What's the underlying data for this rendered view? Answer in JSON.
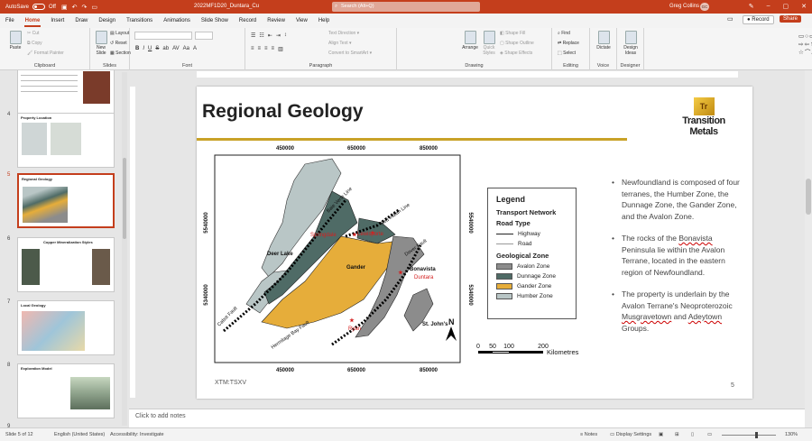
{
  "titlebar": {
    "autosave": "AutoSave",
    "autosave_state": "Off",
    "doc_title": "2022MF1D20_Duntara_Cu",
    "search_placeholder": "Search (Alt+Q)",
    "user": "Greg Collins",
    "initials": "GC"
  },
  "tabs": [
    "File",
    "Home",
    "Insert",
    "Draw",
    "Design",
    "Transitions",
    "Animations",
    "Slide Show",
    "Record",
    "Review",
    "View",
    "Help"
  ],
  "active_tab": "Home",
  "top_right": {
    "record": "Record",
    "share": "Share"
  },
  "ribbon": {
    "clipboard": {
      "label": "Clipboard",
      "paste": "Paste",
      "cut": "Cut",
      "copy": "Copy",
      "format_painter": "Format Painter"
    },
    "slides": {
      "label": "Slides",
      "new_slide": "New Slide",
      "layout": "Layout",
      "reset": "Reset",
      "section": "Section"
    },
    "font": {
      "label": "Font",
      "buttons": [
        "B",
        "I",
        "U",
        "S",
        "ab",
        "AV",
        "Aa",
        "A"
      ]
    },
    "paragraph": {
      "label": "Paragraph",
      "text_direction": "Text Direction",
      "align_text": "Align Text",
      "convert_smartart": "Convert to SmartArt"
    },
    "drawing": {
      "label": "Drawing",
      "arrange": "Arrange",
      "quick_styles": "Quick Styles",
      "shape_fill": "Shape Fill",
      "shape_outline": "Shape Outline",
      "shape_effects": "Shape Effects"
    },
    "editing": {
      "label": "Editing",
      "find": "Find",
      "replace": "Replace",
      "select": "Select"
    },
    "voice": {
      "label": "Voice",
      "dictate": "Dictate"
    },
    "designer": {
      "label": "Designer",
      "design_ideas": "Design Ideas"
    }
  },
  "thumbnails": [
    {
      "num": "",
      "title": ""
    },
    {
      "num": "4",
      "title": "Property Location"
    },
    {
      "num": "5",
      "title": "Regional Geology"
    },
    {
      "num": "6",
      "title": "Copper Mineralization Styles"
    },
    {
      "num": "7",
      "title": "Local Geology"
    },
    {
      "num": "8",
      "title": "Exploration Model"
    },
    {
      "num": "9",
      "title": ""
    }
  ],
  "slide": {
    "title": "Regional Geology",
    "logo": "Transition Metals",
    "logo_mark": "Tr",
    "footer": "XTM:TSXV",
    "page": "5",
    "bullets": [
      [
        "Newfoundland is composed of four terranes, the Humber Zone, the Dunnage Zone, the Gander Zone, and the Avalon Zone."
      ],
      [
        "The rocks of the ",
        "Bonavista",
        " Peninsula lie within the Avalon Terrane, located in the eastern region of Newfoundland."
      ],
      [
        "The property is underlain by the Avalon Terrane's Neoproterozoic ",
        "Musgravetown",
        " and ",
        "Adeytown",
        " Groups."
      ]
    ]
  },
  "map": {
    "x_ticks": [
      "450000",
      "650000",
      "850000"
    ],
    "y_ticks": [
      "5540000",
      "5340000"
    ],
    "faults": [
      "Baie Verte Line",
      "Red Indian Line",
      "Dover Fault",
      "Cabot Fault",
      "Hermitage Bay Fault"
    ],
    "places": [
      "Deer Lake",
      "Gander",
      "Bonavista",
      "St. John's"
    ],
    "red_places": [
      "Springdale",
      "Lewisporte",
      "Duntara",
      "Ryan"
    ],
    "north": "N",
    "scale": [
      "0",
      "50",
      "100",
      "200"
    ],
    "scale_unit": "Kilometres"
  },
  "legend": {
    "title": "Legend",
    "transport": "Transport Network",
    "road_type": "Road Type",
    "roads": [
      "Highway",
      "Road"
    ],
    "geo_zone": "Geological Zone",
    "zones": [
      {
        "name": "Avalon Zone",
        "color": "#8c8c8c"
      },
      {
        "name": "Dunnage Zone",
        "color": "#4f6b66"
      },
      {
        "name": "Gander Zone",
        "color": "#e6ad3a"
      },
      {
        "name": "Humber Zone",
        "color": "#b9c6c6"
      }
    ]
  },
  "notes": "Click to add notes",
  "status": {
    "slide": "Slide 5 of 12",
    "language": "English (United States)",
    "accessibility": "Accessibility: Investigate",
    "notes": "Notes",
    "display": "Display Settings",
    "zoom": "130%"
  }
}
